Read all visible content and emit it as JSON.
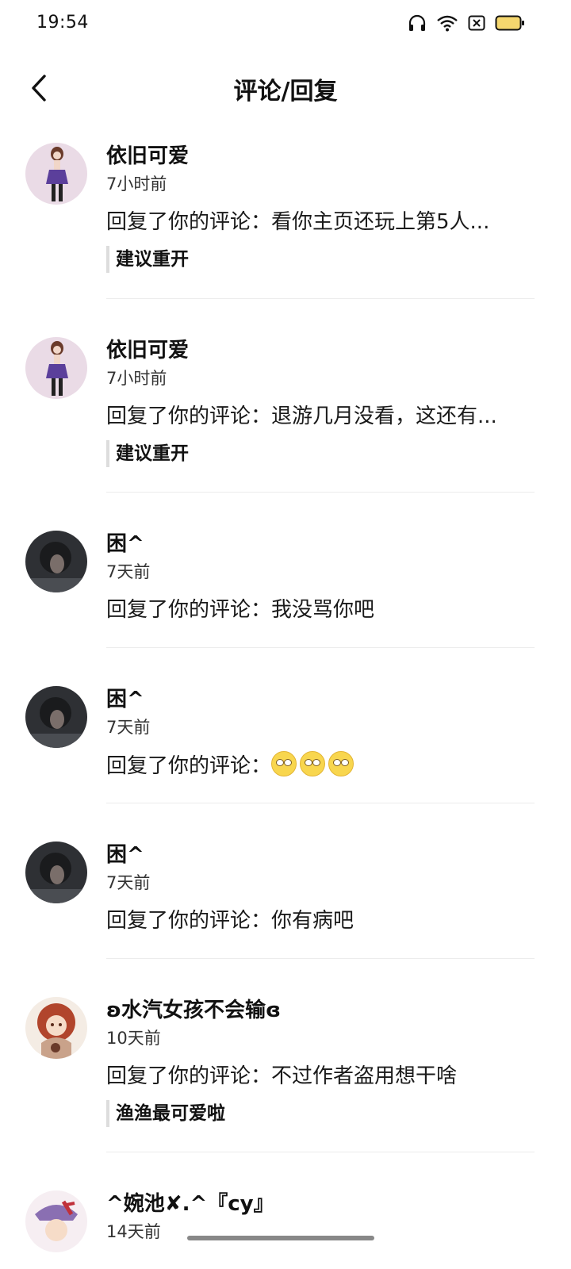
{
  "status_bar": {
    "time": "19:54"
  },
  "header": {
    "title": "评论/回复"
  },
  "colors": {
    "battery": "#f5d76e",
    "avatar_girl_bg": "#eadbe6",
    "avatar_dark_bg": "#3a3c40"
  },
  "notifications": [
    {
      "avatar": "anime-girl-avatar",
      "user": "依旧可爱",
      "time": "7小时前",
      "reply": "回复了你的评论：看你主页还玩上第5人...",
      "quote": "建议重开"
    },
    {
      "avatar": "anime-girl-avatar",
      "user": "依旧可爱",
      "time": "7小时前",
      "reply": "回复了你的评论：退游几月没看，这还有...",
      "quote": "建议重开"
    },
    {
      "avatar": "dark-photo-avatar",
      "user": "困^",
      "time": "7天前",
      "reply": "回复了你的评论：我没骂你吧"
    },
    {
      "avatar": "dark-photo-avatar",
      "user": "困^",
      "time": "7天前",
      "reply": "回复了你的评论：",
      "emoji": "eye-roll-emoji"
    },
    {
      "avatar": "dark-photo-avatar",
      "user": "困^",
      "time": "7天前",
      "reply": "回复了你的评论：你有病吧"
    },
    {
      "avatar": "red-hair-girl-avatar",
      "user": "ʚ水汽女孩不会输ɞ",
      "time": "10天前",
      "reply": "回复了你的评论：不过作者盗用想干啥",
      "quote": "渔渔最可爱啦"
    },
    {
      "avatar": "pink-hat-avatar",
      "user": "^婉池✘.^『cy』",
      "time": "14天前"
    }
  ]
}
